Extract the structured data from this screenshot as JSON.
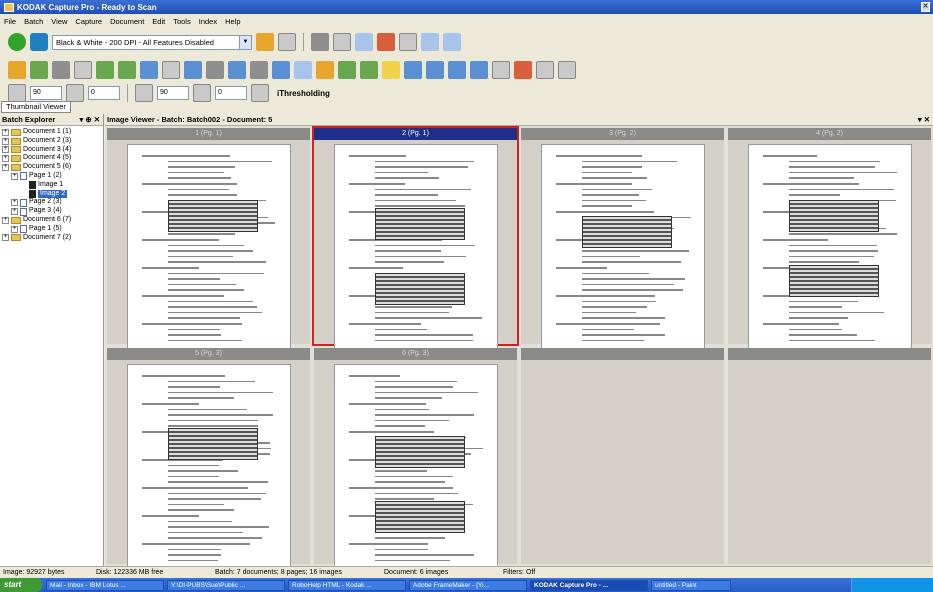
{
  "window": {
    "title": "KODAK Capture Pro - Ready to Scan"
  },
  "menu": [
    "File",
    "Batch",
    "View",
    "Capture",
    "Document",
    "Edit",
    "Tools",
    "Index",
    "Help"
  ],
  "toolbar": {
    "profile": "Black & White - 200 DPI - All Features Disabled",
    "spin1": "90",
    "spin2": "0",
    "spin3": "90",
    "spin4": "0",
    "threshold_label": "iThresholding"
  },
  "thumbnail_tab": "Thumbnail Viewer",
  "left_pane": {
    "title": "Batch Explorer",
    "controls": "▾ ⊕ ✕"
  },
  "tree": [
    {
      "label": "Document 1 (1)",
      "indent": 0,
      "kind": "doc"
    },
    {
      "label": "Document 2 (3)",
      "indent": 0,
      "kind": "doc"
    },
    {
      "label": "Document 3 (4)",
      "indent": 0,
      "kind": "doc"
    },
    {
      "label": "Document 4 (5)",
      "indent": 0,
      "kind": "doc"
    },
    {
      "label": "Document 5 (6)",
      "indent": 0,
      "kind": "doc"
    },
    {
      "label": "Page 1 (2)",
      "indent": 1,
      "kind": "page"
    },
    {
      "label": "Image 1",
      "indent": 2,
      "kind": "image"
    },
    {
      "label": "Image 2",
      "indent": 2,
      "kind": "image",
      "selected": true
    },
    {
      "label": "Page 2 (3)",
      "indent": 1,
      "kind": "page"
    },
    {
      "label": "Page 3 (4)",
      "indent": 1,
      "kind": "page"
    },
    {
      "label": "Document 6 (7)",
      "indent": 0,
      "kind": "doc"
    },
    {
      "label": "Page 1 (5)",
      "indent": 1,
      "kind": "page"
    },
    {
      "label": "Document 7 (2)",
      "indent": 0,
      "kind": "doc"
    }
  ],
  "viewer": {
    "title": "Image Viewer - Batch: Batch002 - Document: 5",
    "controls": "▾ ✕"
  },
  "thumbs": [
    {
      "label": "1 (Pg. 1)",
      "selected": false,
      "empty": false
    },
    {
      "label": "2 (Pg. 1)",
      "selected": true,
      "empty": false
    },
    {
      "label": "3 (Pg. 2)",
      "selected": false,
      "empty": false
    },
    {
      "label": "4 (Pg. 2)",
      "selected": false,
      "empty": false
    },
    {
      "label": "5 (Pg. 3)",
      "selected": false,
      "empty": false
    },
    {
      "label": "6 (Pg. 3)",
      "selected": false,
      "empty": false
    },
    {
      "label": "",
      "selected": false,
      "empty": true
    },
    {
      "label": "",
      "selected": false,
      "empty": true
    }
  ],
  "status": {
    "image": "Image: 92927 bytes",
    "disk": "Disk: 122336 MB free",
    "batch": "Batch: 7 documents; 8 pages; 16 images",
    "document": "Document: 6 images",
    "filters": "Filters: Off"
  },
  "taskbar": {
    "start": "start",
    "tasks": [
      "Mail - Inbox - IBM Lotus ...",
      "Y:\\DI-PUBS\\Sue\\Public ...",
      "RoboHelp HTML - Kodak ...",
      "Adobe FrameMaker - [Yi...",
      "KODAK Capture Pro - ...",
      "untitled - Paint"
    ],
    "active_index": 4
  }
}
